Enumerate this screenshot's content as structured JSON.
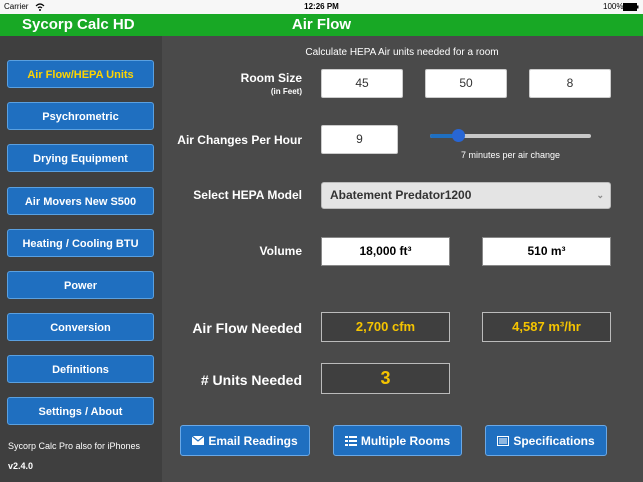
{
  "status_bar": {
    "carrier": "Carrier",
    "time": "12:26 PM",
    "battery": "100%"
  },
  "app": {
    "title": "Sycorp Calc HD",
    "page_title": "Air Flow",
    "accent": "#18a825",
    "highlight": "#ffd400"
  },
  "sidebar": {
    "items": [
      {
        "label": "Air Flow/HEPA Units"
      },
      {
        "label": "Psychrometric"
      },
      {
        "label": "Drying Equipment"
      },
      {
        "label": "Air Movers New S500"
      },
      {
        "label": "Heating / Cooling BTU"
      },
      {
        "label": "Power"
      },
      {
        "label": "Conversion"
      },
      {
        "label": "Definitions"
      },
      {
        "label": "Settings / About"
      }
    ],
    "active_index": 0,
    "footer_note": "Sycorp Calc Pro also for iPhones",
    "version": "v2.4.0"
  },
  "main": {
    "subtitle": "Calculate HEPA Air units needed for a room",
    "room_size": {
      "label": "Room Size",
      "sublabel": "(in Feet)",
      "values": [
        "45",
        "50",
        "8"
      ]
    },
    "air_changes": {
      "label": "Air Changes Per Hour",
      "value": "9",
      "slider_fraction": 0.15,
      "note": "7 minutes per air change"
    },
    "hepa": {
      "label": "Select HEPA Model",
      "selected": "Abatement Predator1200"
    },
    "volume": {
      "label": "Volume",
      "ft3": "18,000 ft³",
      "m3": "510 m³"
    },
    "air_flow": {
      "label": "Air Flow Needed",
      "cfm": "2,700 cfm",
      "m3hr": "4,587 m³/hr"
    },
    "units": {
      "label": "# Units Needed",
      "value": "3"
    },
    "actions": {
      "email": "Email Readings",
      "rooms": "Multiple Rooms",
      "specs": "Specifications"
    }
  }
}
